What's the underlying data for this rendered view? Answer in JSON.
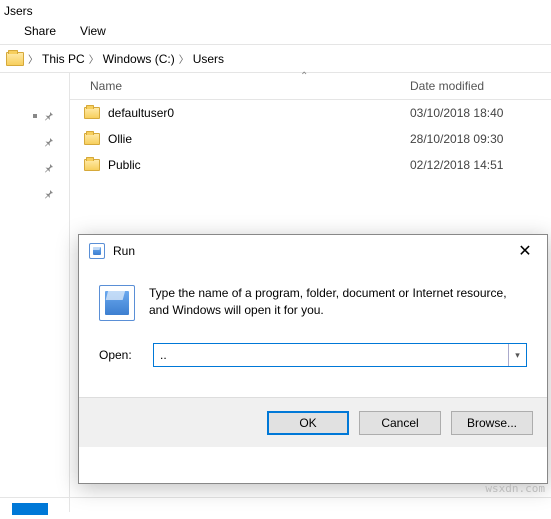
{
  "window": {
    "title": "Jsers"
  },
  "ribbon": {
    "share": "Share",
    "view": "View"
  },
  "breadcrumb": {
    "thispc": "This PC",
    "drive": "Windows (C:)",
    "folder": "Users"
  },
  "columns": {
    "name": "Name",
    "date": "Date modified"
  },
  "rows": [
    {
      "name": "defaultuser0",
      "date": "03/10/2018 18:40"
    },
    {
      "name": "Ollie",
      "date": "28/10/2018 09:30"
    },
    {
      "name": "Public",
      "date": "02/12/2018 14:51"
    }
  ],
  "dialog": {
    "title": "Run",
    "message": "Type the name of a program, folder, document or Internet resource, and Windows will open it for you.",
    "open_label": "Open:",
    "open_value": "..",
    "ok": "OK",
    "cancel": "Cancel",
    "browse": "Browse..."
  },
  "watermark": "wsxdn.com"
}
